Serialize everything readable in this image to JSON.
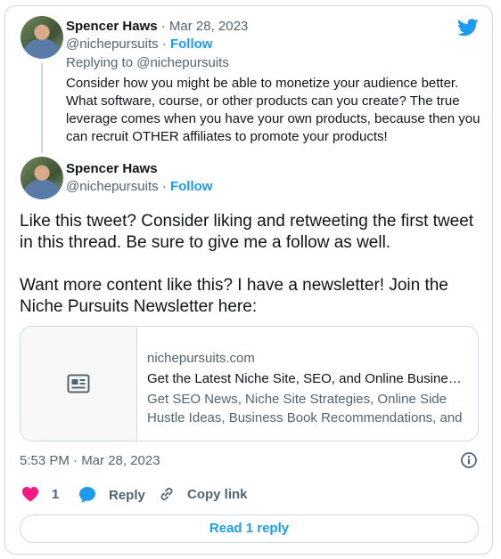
{
  "colors": {
    "accent": "#1d9bf0",
    "like": "#f91880",
    "muted": "#536471",
    "border": "#cfd9de"
  },
  "reply_tweet": {
    "author_name": "Spencer Haws",
    "separator": " · ",
    "date": "Mar 28, 2023",
    "handle": "@nichepursuits",
    "follow_label": "Follow",
    "replying_to": "Replying to @nichepursuits",
    "text": "Consider how you might be able to monetize your audience better. What software, course, or other products can you create?  The true leverage comes when you have your own products, because then you can recruit OTHER affiliates to promote your products!"
  },
  "main_tweet": {
    "author_name": "Spencer Haws",
    "handle": "@nichepursuits",
    "follow_label": "Follow",
    "paragraph_1": "Like this tweet?  Consider liking and retweeting the first tweet in this thread.  Be sure to give me a follow as well.",
    "paragraph_2": "Want more content like this?  I have a newsletter!  Join the Niche Pursuits Newsletter here:",
    "link_card": {
      "domain": "nichepursuits.com",
      "title": "Get the Latest Niche Site, SEO, and Online Business S...",
      "description": "Get SEO News, Niche Site Strategies, Online Side Hustle Ideas, Business Book Recommendations, and ..."
    },
    "timestamp": "5:53 PM · Mar 28, 2023",
    "actions": {
      "like_count": "1",
      "reply_label": "Reply",
      "copy_link_label": "Copy link"
    },
    "read_replies_label": "Read 1 reply"
  },
  "icons": [
    "twitter-bird-icon",
    "newspaper-icon",
    "info-icon",
    "heart-icon",
    "reply-bubble-icon",
    "link-icon"
  ]
}
